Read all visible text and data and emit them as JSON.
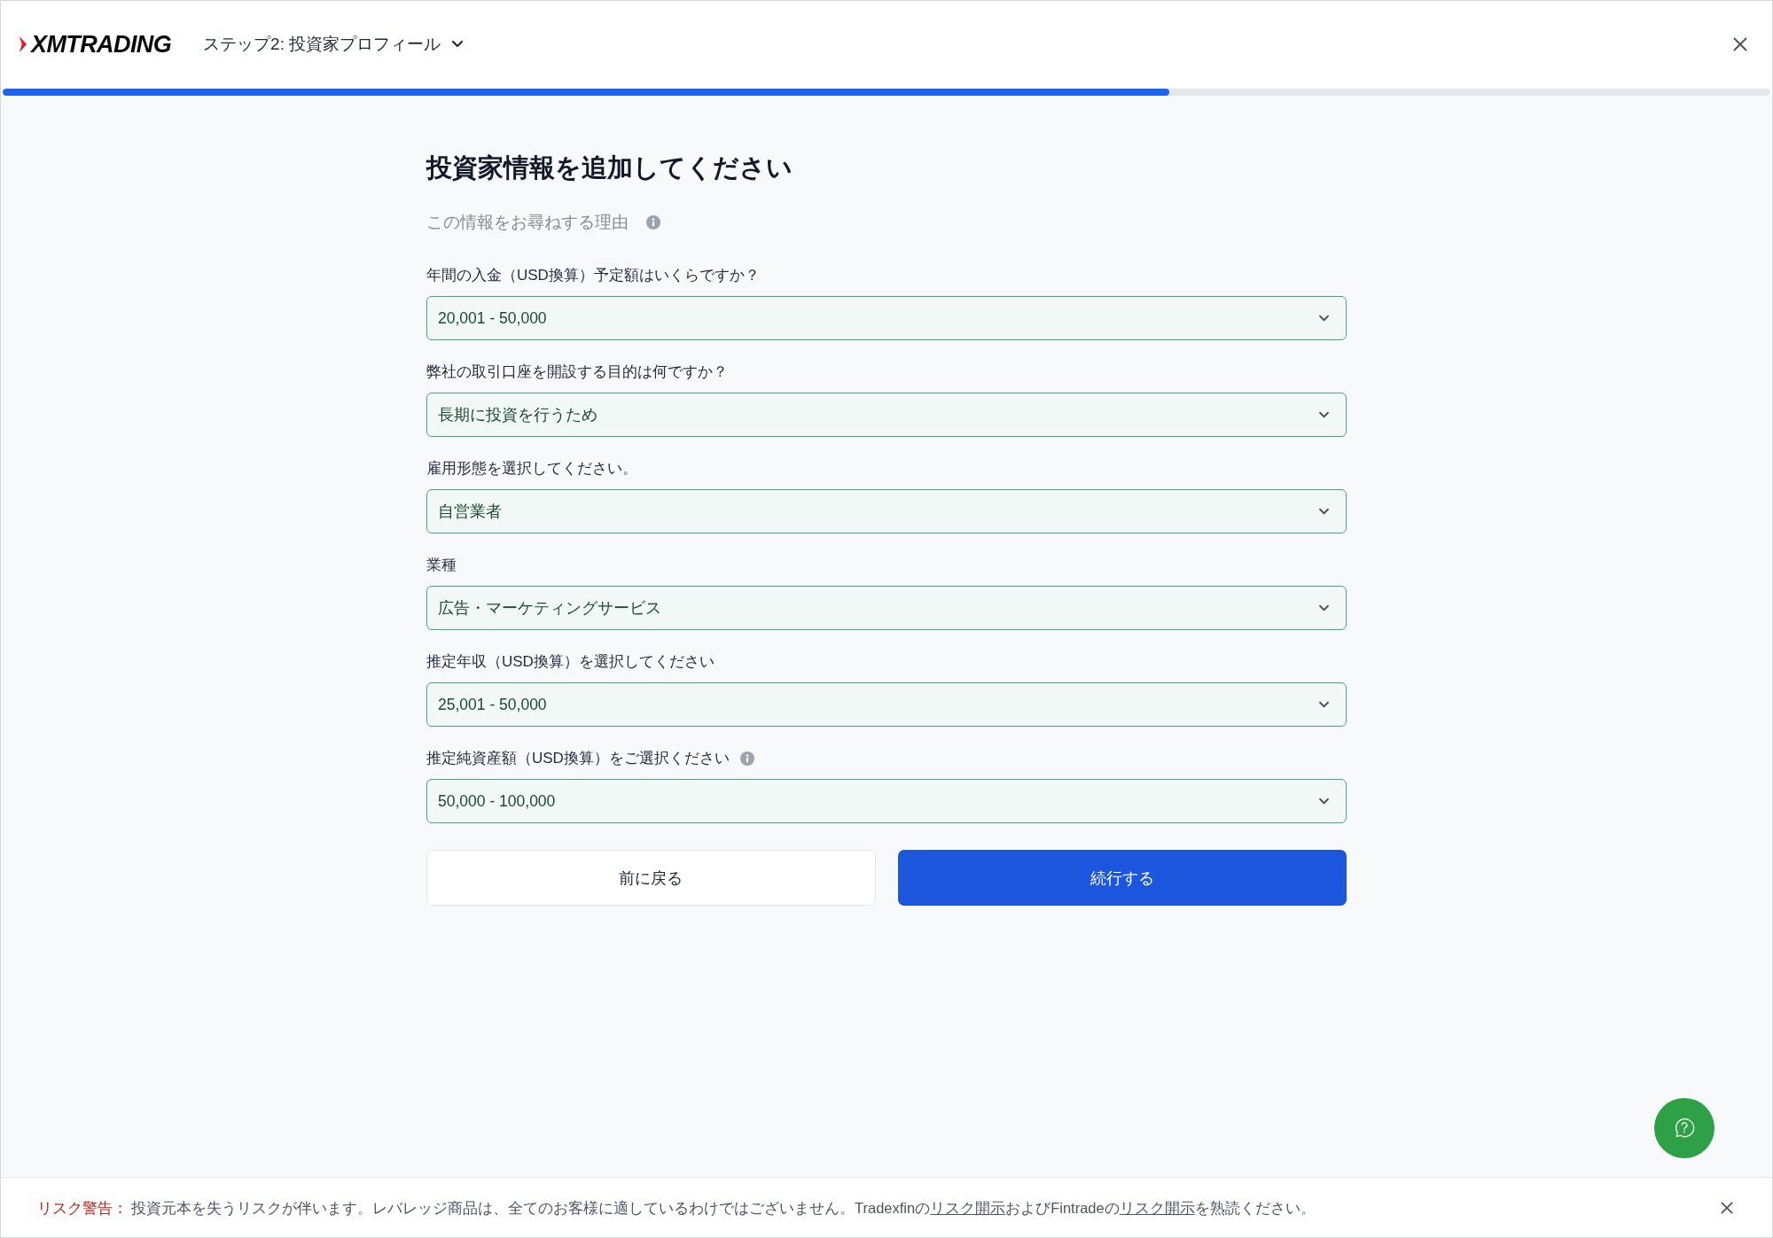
{
  "header": {
    "logo": "XMTRADING",
    "step_title": "ステップ2: 投資家プロフィール",
    "progress": {
      "level": 0.66
    }
  },
  "form": {
    "title": "投資家情報を追加してください",
    "reason": {
      "text": "この情報をお尋ねする理由",
      "info": true
    },
    "fields": [
      {
        "label": "年間の入金（USD換算）予定額はいくらですか？",
        "value": "20,001 - 50,000",
        "info": false,
        "valid": true
      },
      {
        "label": "弊社の取引口座を開設する目的は何ですか？",
        "value": "長期に投資を行うため",
        "info": false,
        "valid": true
      },
      {
        "label": "雇用形態を選択してください。",
        "value": "自営業者",
        "info": false,
        "valid": true
      },
      {
        "label": "業種",
        "value": "広告・マーケティングサービス",
        "info": false,
        "valid": true
      },
      {
        "label": "推定年収（USD換算）を選択してください",
        "value": "25,001 - 50,000",
        "info": false,
        "valid": true
      },
      {
        "label": "推定純資産額（USD換算）をご選択ください",
        "value": "50,000 - 100,000",
        "info": true,
        "valid": true
      }
    ],
    "buttons": [
      {
        "label": "前に戻る",
        "kind": "secondary"
      },
      {
        "label": "続行する",
        "kind": "primary"
      }
    ]
  },
  "risk_warning": {
    "label": "リスク警告：",
    "segments": [
      {
        "text": "投資元本を失うリスクが伴います。レバレッジ商品は、全てのお客様に適しているわけではございません。Tradexfinの",
        "link": false
      },
      {
        "text": "リスク開示",
        "link": true
      },
      {
        "text": "およびFintradeの",
        "link": false
      },
      {
        "text": "リスク開示",
        "link": true
      },
      {
        "text": "を熟読ください。",
        "link": false
      }
    ]
  }
}
